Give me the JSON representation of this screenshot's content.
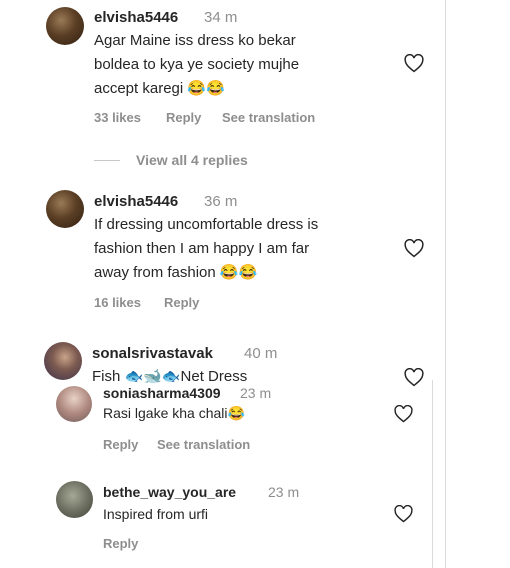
{
  "comments": [
    {
      "username": "elvisha5446",
      "time": "34 m",
      "lines": [
        "Agar Maine iss dress ko bekar",
        "boldea to kya ye society mujhe",
        "accept karegi 😂😂"
      ],
      "likes": "33 likes",
      "reply": "Reply",
      "see_translation": "See translation",
      "view_replies": "View all 4 replies"
    },
    {
      "username": "elvisha5446",
      "time": "36 m",
      "lines": [
        "If dressing uncomfortable dress is",
        "fashion then I am happy I am far",
        "away from fashion 😂😂"
      ],
      "likes": "16 likes",
      "reply": "Reply"
    },
    {
      "username": "sonalsrivastavak",
      "time": "40 m",
      "lines": [
        "Fish 🐟🐋🐟Net Dress"
      ]
    },
    {
      "username": "soniasharma4309",
      "time": "23 m",
      "lines": [
        "Rasi lgake kha chali😂"
      ],
      "reply": "Reply",
      "see_translation": "See translation"
    },
    {
      "username": "bethe_way_you_are",
      "time": "23 m",
      "lines": [
        "Inspired from urfi"
      ],
      "reply": "Reply"
    }
  ],
  "colors": {
    "text": "#262626",
    "muted": "#8e8e8e",
    "divider": "#dbdbdb"
  },
  "icons": {
    "like": "heart-outline-icon"
  }
}
